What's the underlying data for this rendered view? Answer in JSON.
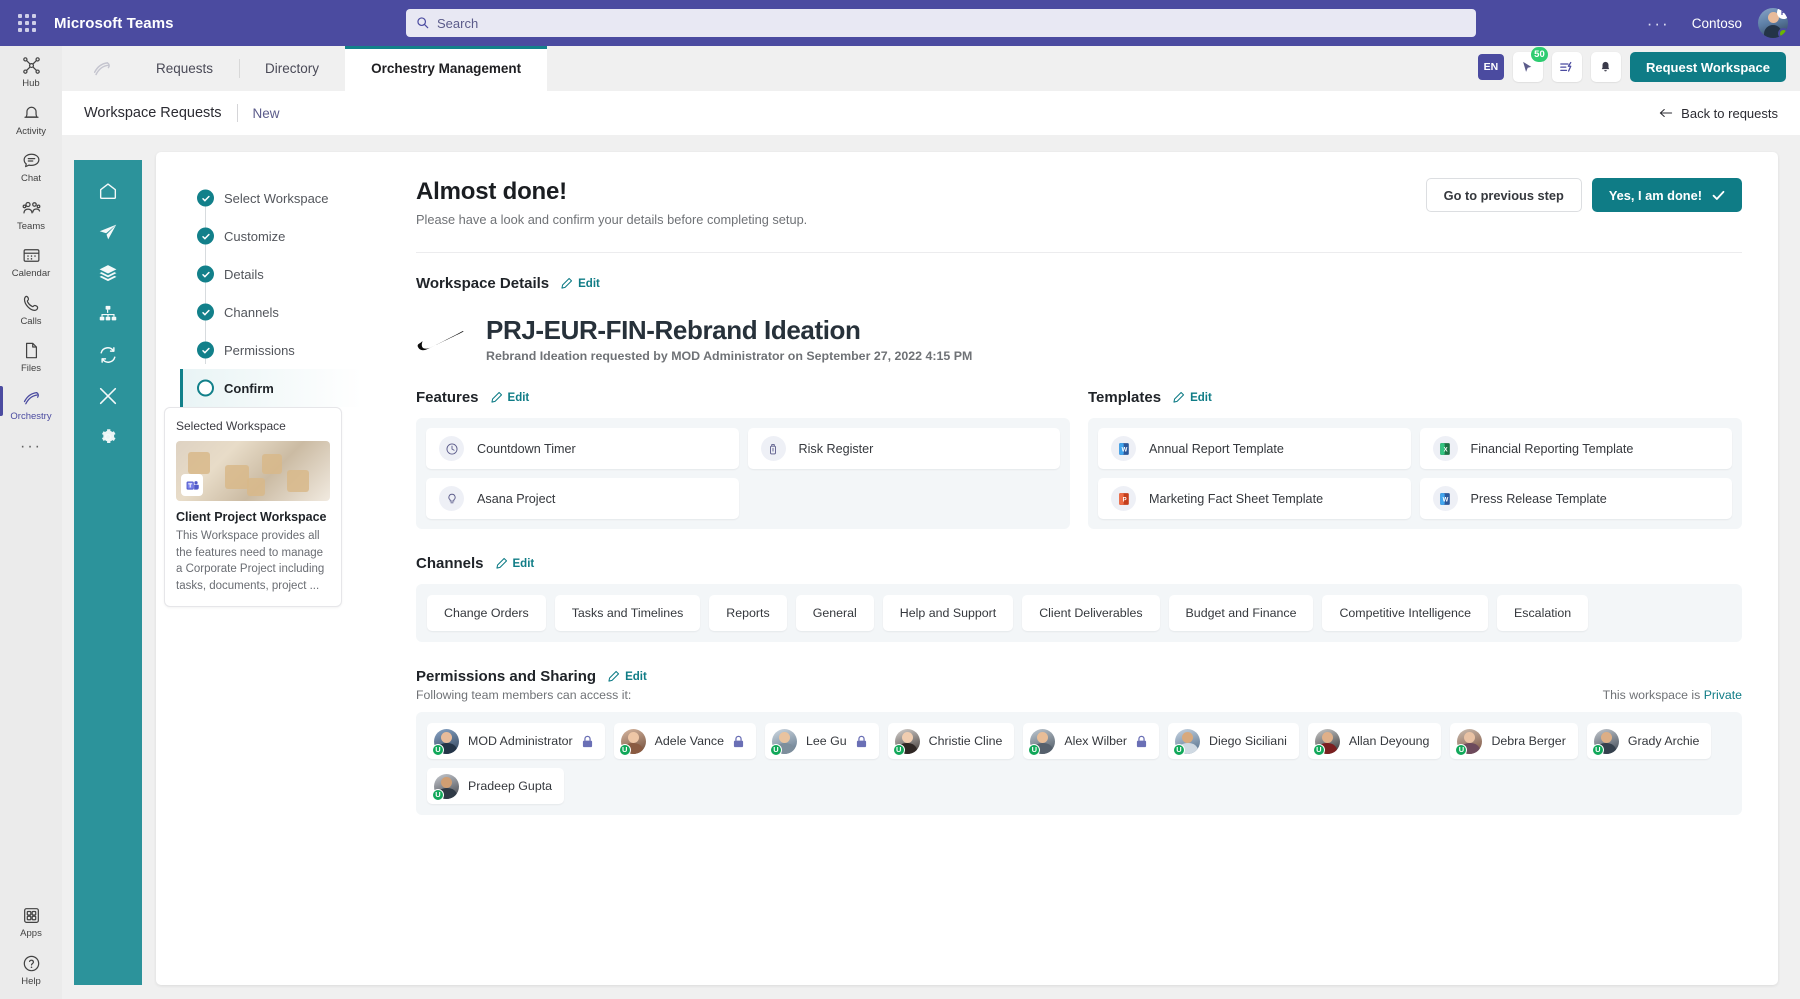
{
  "topbar": {
    "waffle_label": "app-launcher",
    "title": "Microsoft Teams",
    "search_placeholder": "Search",
    "ellipsis": "···",
    "tenant": "Contoso",
    "avatar_badge": "P"
  },
  "rail": {
    "items": [
      {
        "label": "Hub",
        "icon": "hub-icon"
      },
      {
        "label": "Activity",
        "icon": "bell-icon"
      },
      {
        "label": "Chat",
        "icon": "chat-icon"
      },
      {
        "label": "Teams",
        "icon": "teams-icon"
      },
      {
        "label": "Calendar",
        "icon": "calendar-icon"
      },
      {
        "label": "Calls",
        "icon": "phone-icon"
      },
      {
        "label": "Files",
        "icon": "file-icon"
      },
      {
        "label": "Orchestry",
        "icon": "orchestry-icon"
      }
    ],
    "more": "···",
    "bottom": [
      {
        "label": "Apps",
        "icon": "apps-icon"
      },
      {
        "label": "Help",
        "icon": "help-icon"
      }
    ]
  },
  "tabs": {
    "items": [
      {
        "label": "Requests",
        "active": false
      },
      {
        "label": "Directory",
        "active": false
      },
      {
        "label": "Orchestry Management",
        "active": true
      }
    ],
    "lang": "EN",
    "cursor_badge": "50",
    "request_workspace": "Request Workspace"
  },
  "breadcrumb": {
    "main": "Workspace Requests",
    "sub": "New",
    "back": "Back to requests"
  },
  "stepper": {
    "steps": [
      {
        "label": "Select Workspace",
        "state": "done"
      },
      {
        "label": "Customize",
        "state": "done"
      },
      {
        "label": "Details",
        "state": "done"
      },
      {
        "label": "Channels",
        "state": "done"
      },
      {
        "label": "Permissions",
        "state": "done"
      },
      {
        "label": "Confirm",
        "state": "current"
      }
    ]
  },
  "selected_workspace": {
    "label": "Selected Workspace",
    "title": "Client Project Workspace",
    "description": "This Workspace provides all the features need to manage a Corporate Project including tasks, documents, project ..."
  },
  "main": {
    "heading": "Almost done!",
    "subheading": "Please have a look and confirm your details before completing setup.",
    "previous_step": "Go to previous step",
    "done": "Yes, I am done!",
    "edit": "Edit",
    "workspace_details_title": "Workspace Details",
    "workspace_name": "PRJ-EUR-FIN-Rebrand Ideation",
    "workspace_meta": "Rebrand Ideation requested by MOD Administrator on September 27, 2022 4:15 PM",
    "features_title": "Features",
    "features": [
      {
        "label": "Countdown Timer",
        "icon": "clock-icon"
      },
      {
        "label": "Risk Register",
        "icon": "risk-icon"
      },
      {
        "label": "Asana Project",
        "icon": "lightbulb-icon"
      }
    ],
    "templates_title": "Templates",
    "templates": [
      {
        "label": "Annual Report Template",
        "icon": "word-icon",
        "color": "#2b579a"
      },
      {
        "label": "Financial Reporting Template",
        "icon": "excel-icon",
        "color": "#1d7044"
      },
      {
        "label": "Marketing Fact Sheet Template",
        "icon": "powerpoint-icon",
        "color": "#c43e1c"
      },
      {
        "label": "Press Release Template",
        "icon": "word-icon",
        "color": "#2b579a"
      }
    ],
    "channels_title": "Channels",
    "channels": [
      "Change Orders",
      "Tasks and Timelines",
      "Reports",
      "General",
      "Help and Support",
      "Client Deliverables",
      "Budget and Finance",
      "Competitive Intelligence",
      "Escalation"
    ],
    "permissions_title": "Permissions and Sharing",
    "permissions_sub": "Following team members can access it:",
    "privacy_prefix": "This workspace is ",
    "privacy_value": "Private",
    "members": [
      {
        "name": "MOD Administrator",
        "owner": true,
        "badge": "U",
        "c1": "#8aa6c8",
        "c2": "#2e3f55",
        "skin": "#e8bb9a"
      },
      {
        "name": "Adele Vance",
        "owner": true,
        "badge": "U",
        "c1": "#d8b7a0",
        "c2": "#6d4a38",
        "skin": "#eec6a6"
      },
      {
        "name": "Lee Gu",
        "owner": true,
        "badge": "U",
        "c1": "#cfd9e2",
        "c2": "#5d7387",
        "skin": "#e9c39f"
      },
      {
        "name": "Christie Cline",
        "owner": false,
        "badge": "U",
        "c1": "#d7d3d0",
        "c2": "#3a3330",
        "skin": "#f0cdb0"
      },
      {
        "name": "Alex Wilber",
        "owner": true,
        "badge": "U",
        "c1": "#bfc9d2",
        "c2": "#4a545f",
        "skin": "#e8bd97"
      },
      {
        "name": "Diego Siciliani",
        "owner": false,
        "badge": "U",
        "c1": "#c9d6e4",
        "c2": "#4e6a86",
        "skin": "#d8a97d"
      },
      {
        "name": "Allan Deyoung",
        "owner": false,
        "badge": "U",
        "c1": "#cbcbcb",
        "c2": "#2f2f2f",
        "skin": "#e0b089"
      },
      {
        "name": "Debra Berger",
        "owner": false,
        "badge": "U",
        "c1": "#cdbfb2",
        "c2": "#7b4f3c",
        "skin": "#e9c2a4"
      },
      {
        "name": "Grady Archie",
        "owner": false,
        "badge": "U",
        "c1": "#c4c9cf",
        "c2": "#3b4450",
        "skin": "#dcae85"
      },
      {
        "name": "Pradeep Gupta",
        "owner": false,
        "badge": "U",
        "c1": "#c8cbd0",
        "c2": "#3c4048",
        "skin": "#cf9e73"
      }
    ]
  },
  "colors": {
    "teams_purple": "#4b4ba0",
    "teal": "#0f7c86",
    "teal_rail": "#2c939b",
    "green_badge": "#2ecc71"
  }
}
